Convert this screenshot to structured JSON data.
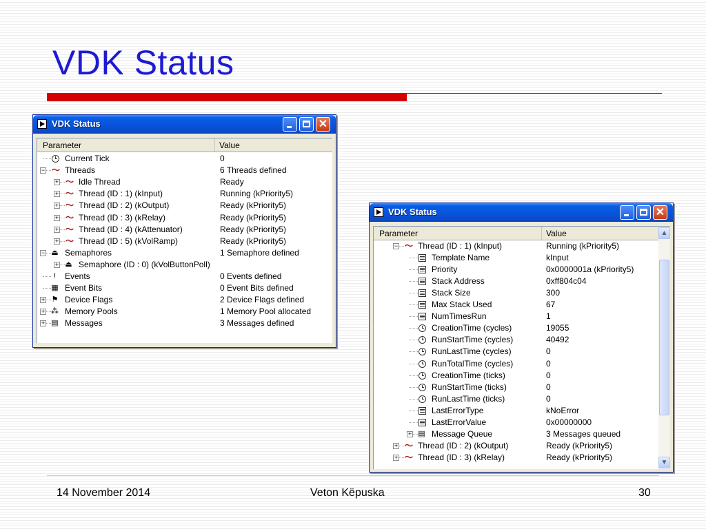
{
  "slide": {
    "title": "VDK Status",
    "footer_date": "14 November 2014",
    "footer_author": "Veton Këpuska",
    "footer_page": "30",
    "accent_color": "#d40000",
    "title_color": "#1d1ad3"
  },
  "window1": {
    "title": "VDK Status",
    "col_param": "Parameter",
    "col_value": "Value",
    "rows": [
      {
        "name": "Current Tick",
        "value": "0",
        "level": 0,
        "icon": "clock-icon",
        "expander": "none"
      },
      {
        "name": "Threads",
        "value": "6 Threads defined",
        "level": 0,
        "icon": "thread-icon",
        "expander": "minus"
      },
      {
        "name": "Idle Thread",
        "value": "Ready",
        "level": 1,
        "icon": "thread-icon",
        "expander": "plus"
      },
      {
        "name": "Thread (ID : 1) (kInput)",
        "value": "Running (kPriority5)",
        "level": 1,
        "icon": "thread-icon",
        "expander": "plus"
      },
      {
        "name": "Thread (ID : 2) (kOutput)",
        "value": "Ready (kPriority5)",
        "level": 1,
        "icon": "thread-icon",
        "expander": "plus"
      },
      {
        "name": "Thread (ID : 3) (kRelay)",
        "value": "Ready (kPriority5)",
        "level": 1,
        "icon": "thread-icon",
        "expander": "plus"
      },
      {
        "name": "Thread (ID : 4) (kAttenuator)",
        "value": "Ready (kPriority5)",
        "level": 1,
        "icon": "thread-icon",
        "expander": "plus"
      },
      {
        "name": "Thread (ID : 5) (kVolRamp)",
        "value": "Ready (kPriority5)",
        "level": 1,
        "icon": "thread-icon",
        "expander": "plus"
      },
      {
        "name": "Semaphores",
        "value": "1 Semaphore defined",
        "level": 0,
        "icon": "semaphore-icon",
        "expander": "minus"
      },
      {
        "name": "Semaphore (ID : 0) (kVolButtonPoll)",
        "value": "",
        "level": 1,
        "icon": "semaphore-icon",
        "expander": "plus"
      },
      {
        "name": "Events",
        "value": "0 Events defined",
        "level": 0,
        "icon": "event-icon",
        "expander": "none"
      },
      {
        "name": "Event Bits",
        "value": "0 Event Bits defined",
        "level": 0,
        "icon": "event-bits-icon",
        "expander": "none"
      },
      {
        "name": "Device Flags",
        "value": "2 Device Flags defined",
        "level": 0,
        "icon": "device-flag-icon",
        "expander": "plus"
      },
      {
        "name": "Memory Pools",
        "value": "1 Memory Pool allocated",
        "level": 0,
        "icon": "memory-pool-icon",
        "expander": "plus"
      },
      {
        "name": "Messages",
        "value": "3 Messages defined",
        "level": 0,
        "icon": "message-icon",
        "expander": "plus"
      }
    ]
  },
  "window2": {
    "title": "VDK Status",
    "col_param": "Parameter",
    "col_value": "Value",
    "rows": [
      {
        "name": "Thread (ID : 1) (kInput)",
        "value": "Running (kPriority5)",
        "level": 1,
        "icon": "thread-icon",
        "expander": "minus"
      },
      {
        "name": "Template Name",
        "value": "kInput",
        "level": 2,
        "icon": "property-icon",
        "expander": "none"
      },
      {
        "name": "Priority",
        "value": "0x0000001a (kPriority5)",
        "level": 2,
        "icon": "property-icon",
        "expander": "none"
      },
      {
        "name": "Stack Address",
        "value": "0xff804c04",
        "level": 2,
        "icon": "property-icon",
        "expander": "none"
      },
      {
        "name": "Stack Size",
        "value": "300",
        "level": 2,
        "icon": "property-icon",
        "expander": "none"
      },
      {
        "name": "Max Stack Used",
        "value": "67",
        "level": 2,
        "icon": "property-icon",
        "expander": "none"
      },
      {
        "name": "NumTimesRun",
        "value": "1",
        "level": 2,
        "icon": "property-icon",
        "expander": "none"
      },
      {
        "name": "CreationTime (cycles)",
        "value": "19055",
        "level": 2,
        "icon": "clock-icon",
        "expander": "none"
      },
      {
        "name": "RunStartTime (cycles)",
        "value": "40492",
        "level": 2,
        "icon": "clock-icon",
        "expander": "none"
      },
      {
        "name": "RunLastTime (cycles)",
        "value": "0",
        "level": 2,
        "icon": "clock-icon",
        "expander": "none"
      },
      {
        "name": "RunTotalTime (cycles)",
        "value": "0",
        "level": 2,
        "icon": "clock-icon",
        "expander": "none"
      },
      {
        "name": "CreationTime (ticks)",
        "value": "0",
        "level": 2,
        "icon": "clock-icon",
        "expander": "none"
      },
      {
        "name": "RunStartTime (ticks)",
        "value": "0",
        "level": 2,
        "icon": "clock-icon",
        "expander": "none"
      },
      {
        "name": "RunLastTime (ticks)",
        "value": "0",
        "level": 2,
        "icon": "clock-icon",
        "expander": "none"
      },
      {
        "name": "LastErrorType",
        "value": "kNoError",
        "level": 2,
        "icon": "property-icon",
        "expander": "none"
      },
      {
        "name": "LastErrorValue",
        "value": "0x00000000",
        "level": 2,
        "icon": "property-icon",
        "expander": "none"
      },
      {
        "name": "Message Queue",
        "value": "3 Messages queued",
        "level": 2,
        "icon": "message-icon",
        "expander": "plus"
      },
      {
        "name": "Thread (ID : 2) (kOutput)",
        "value": "Ready (kPriority5)",
        "level": 1,
        "icon": "thread-icon",
        "expander": "plus"
      },
      {
        "name": "Thread (ID : 3) (kRelay)",
        "value": "Ready (kPriority5)",
        "level": 1,
        "icon": "thread-icon",
        "expander": "plus"
      }
    ]
  }
}
